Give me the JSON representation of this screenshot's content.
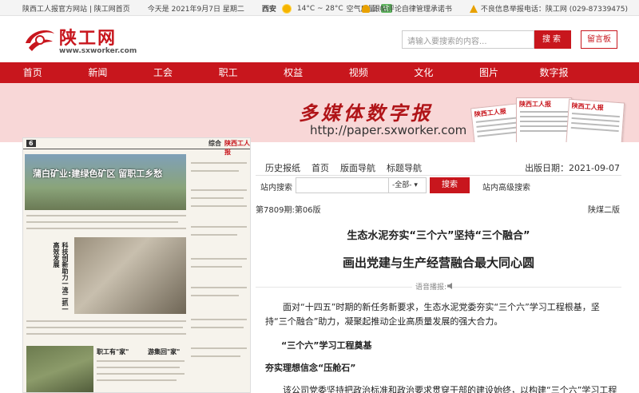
{
  "topbar": {
    "site_links": "陕西工人报官方网站 | 陕工网首页",
    "date": "今天是 2021年9月7日 星期二",
    "city": "西安",
    "temperature": "14°C ~ 28°C",
    "air_quality_label": "空气质量:",
    "air_quality_value": "优",
    "commitment": "跟帖评论自律管理承诺书",
    "report_hotline": "不良信息举报电话：陕工网 (029-87339475)"
  },
  "header": {
    "logo_text": "陕工网",
    "logo_url": "www.sxworker.com",
    "search_placeholder": "请输入要搜索的内容...",
    "search_button": "搜索",
    "guestbook_button": "留言板"
  },
  "nav": {
    "items": [
      "首页",
      "新闻",
      "工会",
      "职工",
      "权益",
      "视频",
      "文化",
      "图片",
      "数字报"
    ]
  },
  "banner": {
    "title": "多媒体数字报",
    "url": "http://paper.sxworker.com",
    "paper_name": "陕西工人报"
  },
  "paper_preview": {
    "page_number": "6",
    "section": "综合",
    "masthead": "陕西工人报",
    "headline": "蒲白矿业:建绿色矿区 留职工乡愁",
    "vertical_headline": "科技创新助力一流二抓一高效发展",
    "sub1": "职工有\"家\"",
    "sub2": "游集回\"家\""
  },
  "article": {
    "subnav": [
      "历史报纸",
      "首页",
      "版面导航",
      "标题导航"
    ],
    "publish_date": "出版日期：2021-09-07",
    "site_search_label": "站内搜索",
    "site_search_select": "-全部-",
    "site_search_button": "搜索",
    "advanced_search": "站内高级搜索",
    "issue": "第7809期:第06版",
    "edition": "陕煤二版",
    "title1": "生态水泥夯实“三个六”坚持“三个融合”",
    "title2": "画出党建与生产经营融合最大同心圆",
    "audio_label": "语音播报:",
    "para1": "面对“十四五”时期的新任务新要求，生态水泥党委夯实“三个六”学习工程根基，坚持“三个融合”助力，凝聚起推动企业高质量发展的强大合力。",
    "section1": "“三个六”学习工程奠基",
    "section2": "夯实理想信念“压舱石”",
    "para2": "该公司党委坚持把政治标准和政治要求贯穿干部的建设始终，以构建“三个六”学习工程强化"
  }
}
